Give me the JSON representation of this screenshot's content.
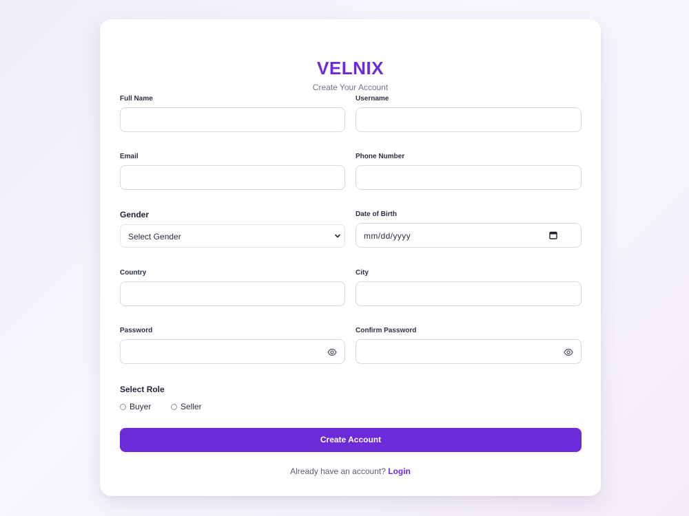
{
  "brand": {
    "name": "VELNIX",
    "subtitle": "Create Your Account"
  },
  "fields": {
    "full_name": {
      "label": "Full Name",
      "value": ""
    },
    "username": {
      "label": "Username",
      "value": ""
    },
    "email": {
      "label": "Email",
      "value": ""
    },
    "phone": {
      "label": "Phone Number",
      "value": ""
    },
    "gender": {
      "label": "Gender",
      "selected": "Select Gender"
    },
    "dob": {
      "label": "Date of Birth",
      "placeholder": "mm/dd/yyyy"
    },
    "country": {
      "label": "Country",
      "value": ""
    },
    "city": {
      "label": "City",
      "value": ""
    },
    "password": {
      "label": "Password",
      "value": ""
    },
    "confirm_password": {
      "label": "Confirm Password",
      "value": ""
    }
  },
  "role": {
    "label": "Select Role",
    "options": [
      "Buyer",
      "Seller"
    ]
  },
  "submit_label": "Create Account",
  "footer": {
    "text": "Already have an account?",
    "link": "Login"
  },
  "colors": {
    "accent": "#6d2adb",
    "background": "#f4f2fb"
  },
  "icons": {
    "password_toggle": "eye-icon",
    "date_picker": "calendar-icon",
    "select_arrow": "chevron-down-icon"
  }
}
